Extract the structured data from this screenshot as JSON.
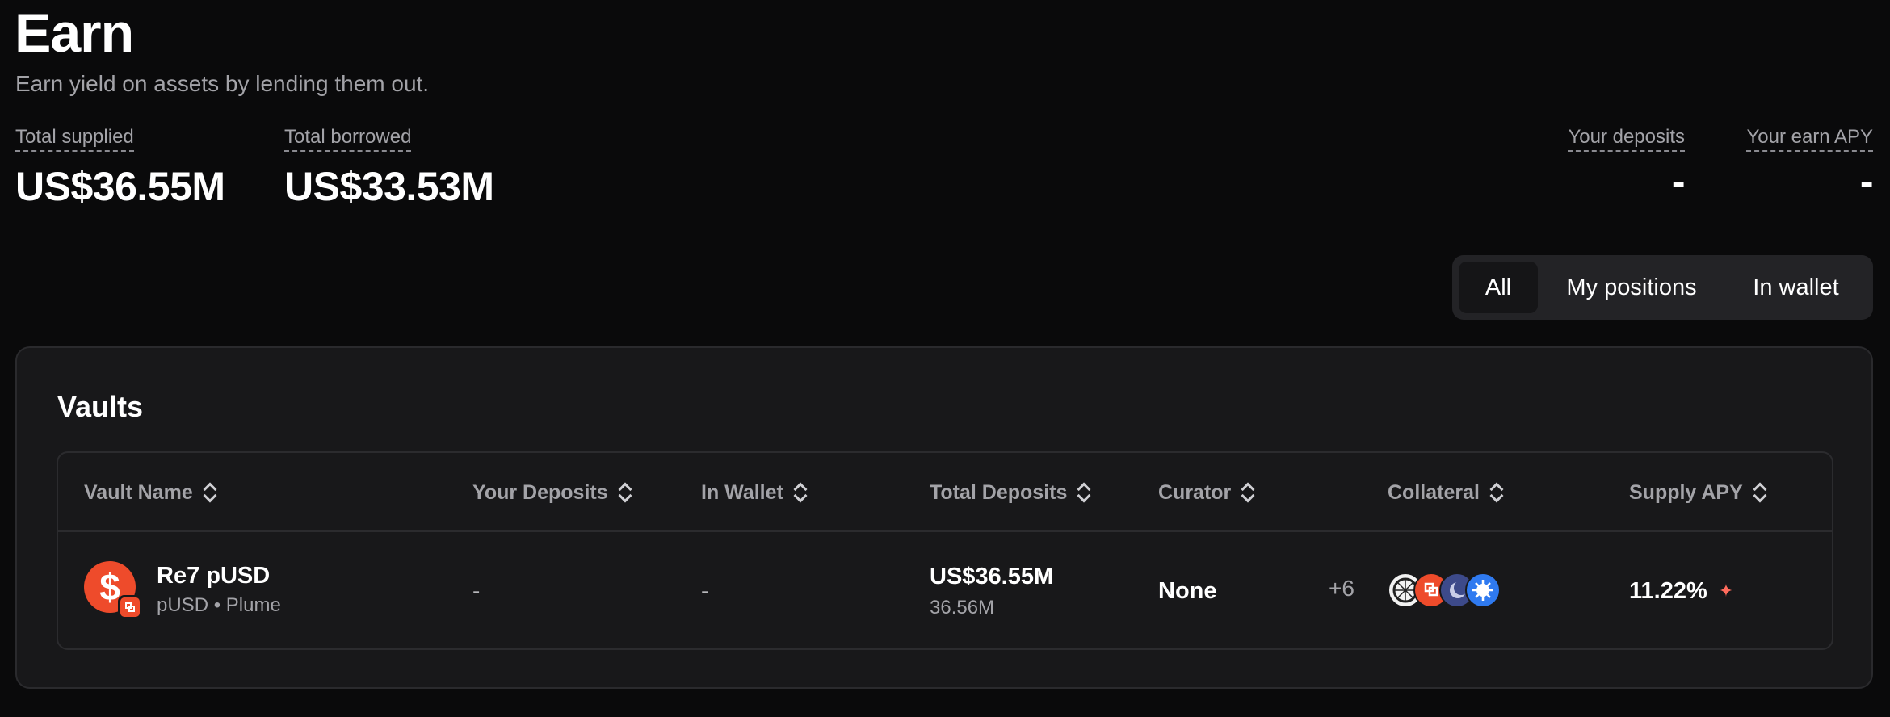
{
  "header": {
    "title": "Earn",
    "subtitle": "Earn yield on assets by lending them out."
  },
  "stats": {
    "total_supplied": {
      "label": "Total supplied",
      "value": "US$36.55M"
    },
    "total_borrowed": {
      "label": "Total borrowed",
      "value": "US$33.53M"
    },
    "your_deposits": {
      "label": "Your deposits",
      "value": "-"
    },
    "your_earn_apy": {
      "label": "Your earn APY",
      "value": "-"
    }
  },
  "filter": {
    "options": [
      "All",
      "My positions",
      "In wallet"
    ],
    "selected": "All"
  },
  "vaults": {
    "title": "Vaults",
    "columns": [
      "Vault Name",
      "Your Deposits",
      "In Wallet",
      "Total Deposits",
      "Curator",
      "Collateral",
      "Supply APY"
    ],
    "rows": [
      {
        "icon": "dollar-icon",
        "name": "Re7 pUSD",
        "subtitle": "pUSD • Plume",
        "your_deposits": "-",
        "in_wallet": "-",
        "total_deposits_usd": "US$36.55M",
        "total_deposits_amount": "36.56M",
        "curator": "None",
        "collateral_more": "+6",
        "supply_apy": "11.22%"
      }
    ]
  },
  "colors": {
    "background": "#0a0a0b",
    "panel": "#18181a",
    "accent": "#ee4b2b",
    "muted_text": "#a3a3a8"
  }
}
